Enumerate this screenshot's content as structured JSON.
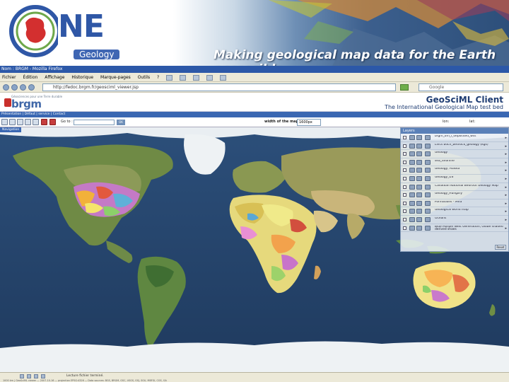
{
  "banner": {
    "logo_text": "NE",
    "logo_sub": "Geology",
    "tagline": "Making geological map data for the Earth accessible"
  },
  "browser": {
    "title": "Nom : BRGM - Mozilla Firefox",
    "menus": [
      "Fichier",
      "Édition",
      "Affichage",
      "Historique",
      "Marque-pages",
      "Outils",
      "?"
    ],
    "url": "http://fedoc.brgm.fr/geosciml_viewer.jsp",
    "search_placeholder": "Google"
  },
  "app": {
    "brgm_tagline": "Géosciences pour une Terre durable",
    "brgm_name": "brgm",
    "title": "GeoSciML Client",
    "subtitle": "The International Geological Map test bed",
    "presentation_bar": "Présentation | Défaut | service | Contact",
    "goto_label": "Go to :",
    "ok_label": "OK",
    "width_label": "width of the map :",
    "width_value": "1600px",
    "lon_label": "lon:",
    "lat_label": "lat:",
    "map_label": "Navigation"
  },
  "layers": {
    "header": "Layers",
    "reset_label": "Reset",
    "items": [
      {
        "name": "brgm_om_l_deposited_wss"
      },
      {
        "name": "Lincs bdcn_bedrock_geology (Kgs)"
      },
      {
        "name": "Geology"
      },
      {
        "name": "sea_dhorline"
      },
      {
        "name": "Geology, Alaska"
      },
      {
        "name": "Geology_US"
      },
      {
        "name": "Canadian National Bedrock Geology Map"
      },
      {
        "name": "Geology_Hungary"
      },
      {
        "name": "Formations - Mira"
      },
      {
        "name": "Geological world map"
      },
      {
        "name": "Oceans"
      },
      {
        "name": "Blue Marble Next Generation, Globe shaded derived shaes"
      }
    ]
  },
  "status": {
    "text": "Lecture fichier terminé.",
    "coords": "1000 km | GeoSciML viewer — 2007-10-16 — projection EPSG:4326 — Data sources: BGS, BRGM, GSC, USGS, GSJ, SGU, MBFGI, CGS, GA"
  },
  "colors": {
    "ocean": "#27476e",
    "accent_blue": "#3a67b2",
    "logo_blue": "#2f57a6",
    "logo_red": "#d32f2f"
  }
}
